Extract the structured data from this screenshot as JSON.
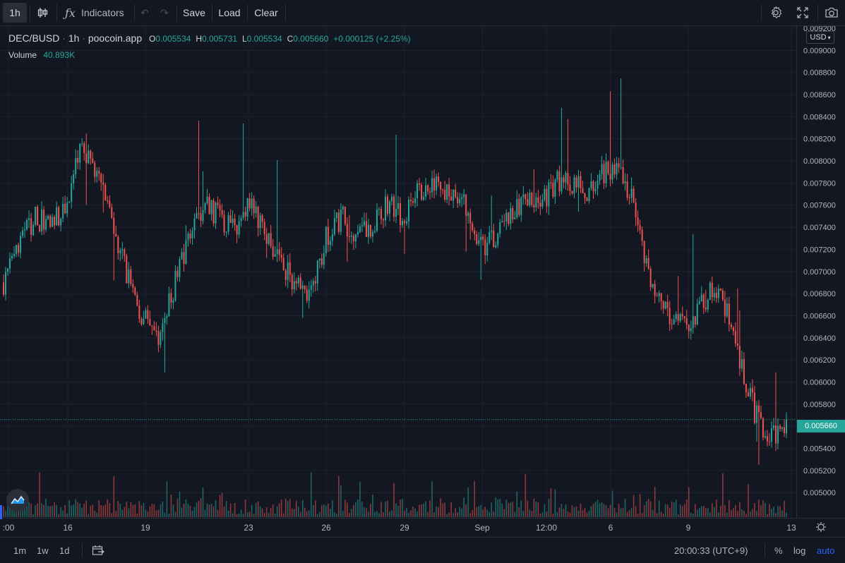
{
  "toolbar": {
    "interval": "1h",
    "indicators_label": "Indicators",
    "save_label": "Save",
    "load_label": "Load",
    "clear_label": "Clear"
  },
  "legend": {
    "symbol": "DEC/BUSD",
    "interval": "1h",
    "source": "poocoin.app",
    "o_label": "O",
    "o_value": "0.005534",
    "h_label": "H",
    "h_value": "0.005731",
    "l_label": "L",
    "l_value": "0.005534",
    "c_label": "C",
    "c_value": "0.005660",
    "change": "+0.000125 (+2.25%)",
    "volume_label": "Volume",
    "volume_value": "40.893K"
  },
  "currency": "USD",
  "last_price": "0.005660",
  "colors": {
    "up": "#26a69a",
    "down": "#ef5350",
    "bg": "#131722",
    "grid": "#1e222d",
    "accent": "#2962ff"
  },
  "bottom": {
    "ranges": [
      "1m",
      "1w",
      "1d"
    ],
    "time": "20:00:33 (UTC+9)",
    "percent": "%",
    "log": "log",
    "auto": "auto"
  },
  "chart_data": {
    "type": "candlestick",
    "price_ticks": [
      "0.009200",
      "0.009000",
      "0.008800",
      "0.008600",
      "0.008400",
      "0.008200",
      "0.008000",
      "0.007800",
      "0.007600",
      "0.007400",
      "0.007200",
      "0.007000",
      "0.006800",
      "0.006600",
      "0.006400",
      "0.006200",
      "0.006000",
      "0.005800",
      "0.005600",
      "0.005400",
      "0.005200",
      "0.005000"
    ],
    "x_ticks": [
      ":00",
      "16",
      "19",
      "23",
      "26",
      "29",
      "Sep",
      "12:00",
      "6",
      "9",
      "13"
    ],
    "ylim": [
      0.00488,
      0.0092
    ],
    "approx_close_path": [
      0.0069,
      0.0072,
      0.0075,
      0.0074,
      0.0076,
      0.0081,
      0.0079,
      0.0075,
      0.007,
      0.0066,
      0.0064,
      0.0068,
      0.0073,
      0.0076,
      0.0075,
      0.0074,
      0.0076,
      0.0074,
      0.0071,
      0.0069,
      0.0068,
      0.0073,
      0.0075,
      0.0073,
      0.0074,
      0.0076,
      0.0075,
      0.0077,
      0.0078,
      0.0077,
      0.0076,
      0.0072,
      0.0073,
      0.0075,
      0.0077,
      0.0076,
      0.0078,
      0.0078,
      0.0077,
      0.0079,
      0.0079,
      0.0077,
      0.007,
      0.0067,
      0.0065,
      0.0066,
      0.0068,
      0.0067,
      0.0062,
      0.0057,
      0.0055,
      0.0056
    ]
  }
}
